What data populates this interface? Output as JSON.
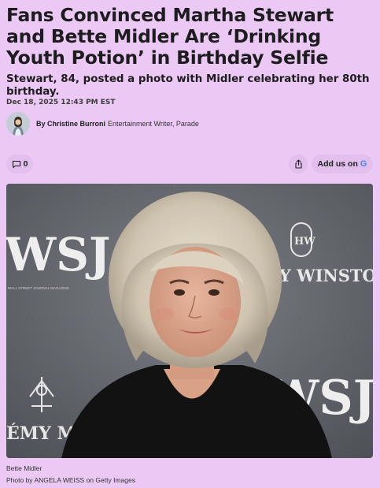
{
  "article": {
    "headline": "Fans Convinced Martha Stewart and Bette Midler Are ‘Drinking Youth Potion’ in Birthday Selfie",
    "subheadline": "Stewart, 84, posted a photo with Midler celebrating her 80th birthday.",
    "date": "Dec 18, 2025 12:43 PM EST"
  },
  "byline": {
    "by": "By Christine Burroni",
    "role": "Entertainment Writer, Parade"
  },
  "actions": {
    "comment_count": "0",
    "google_label": "Add us on",
    "google_glyph": "G",
    "comment_icon": "comment-icon",
    "share_icon": "share-icon"
  },
  "photo": {
    "backdrop_left": "WSJ.",
    "backdrop_left_small": "WALL STREET JOURNAL MAGAZINE",
    "backdrop_right": "RY WINSTON",
    "backdrop_right_logo": "HW",
    "backdrop_bottom_left": "ÉMY MART",
    "backdrop_bottom_right": "WSJ."
  },
  "caption": {
    "subject": "Bette Midler",
    "credit": "Photo by ANGELA WEISS on Getty Images"
  }
}
